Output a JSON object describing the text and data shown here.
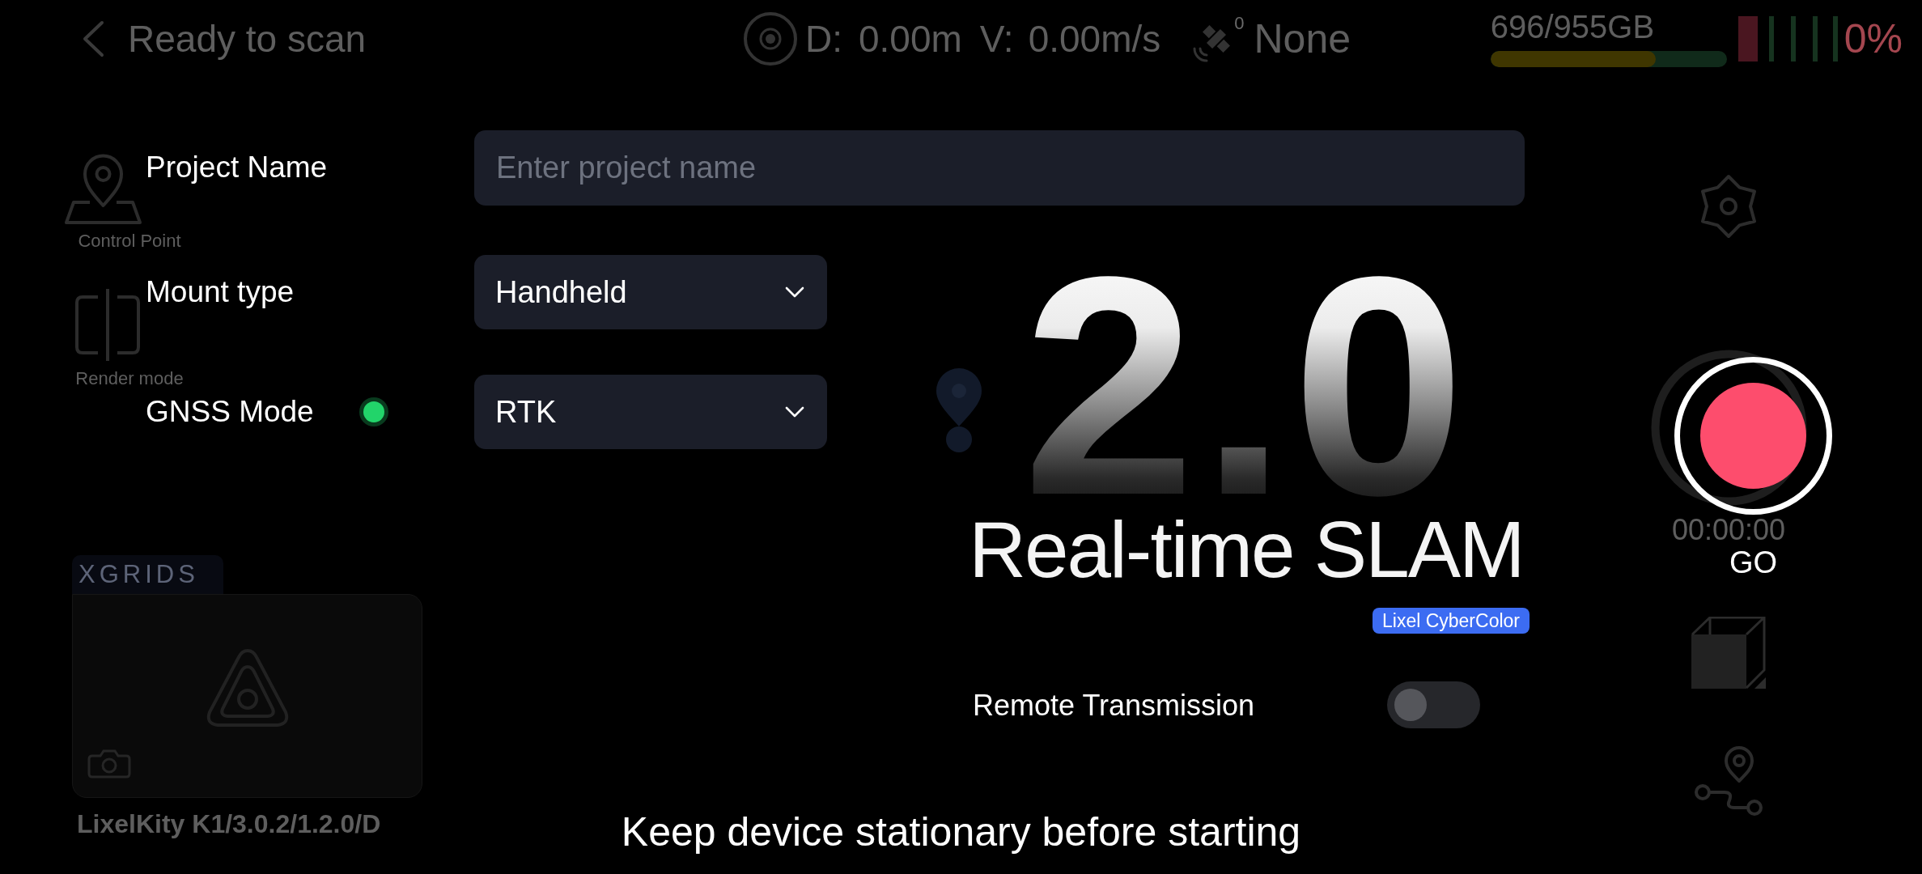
{
  "status_bar": {
    "title": "Ready to scan",
    "distance": {
      "label": "D:",
      "value": "0.00m"
    },
    "speed": {
      "label": "V:",
      "value": "0.00m/s"
    },
    "satellite_count": "0",
    "gnss_status": "None",
    "storage": {
      "text": "696/955GB",
      "level": 0.7
    },
    "battery": "0%"
  },
  "tools": [
    {
      "kind": "control_point",
      "label": "Control Point"
    },
    {
      "kind": "render_mode",
      "label": "Render mode"
    }
  ],
  "device_card": {
    "brand": "XGRIDS",
    "info": "LixelKity K1/3.0.2/1.2.0/D"
  },
  "form": {
    "fields": [
      {
        "kind": "text",
        "label": "Project Name",
        "placeholder": "Enter project name"
      },
      {
        "kind": "select",
        "label": "Mount type",
        "value": "Handheld"
      },
      {
        "kind": "select",
        "label": "GNSS Mode",
        "color": "#22d46a",
        "value": "RTK"
      }
    ]
  },
  "splash": {
    "version": "2.0",
    "title": "Real-time SLAM",
    "badge": "Lixel CyberColor"
  },
  "remote_transmission": {
    "label": "Remote Transmission",
    "on": false
  },
  "record": {
    "timer": "00:00:00",
    "label": "GO"
  },
  "hint": "Keep device stationary before starting"
}
